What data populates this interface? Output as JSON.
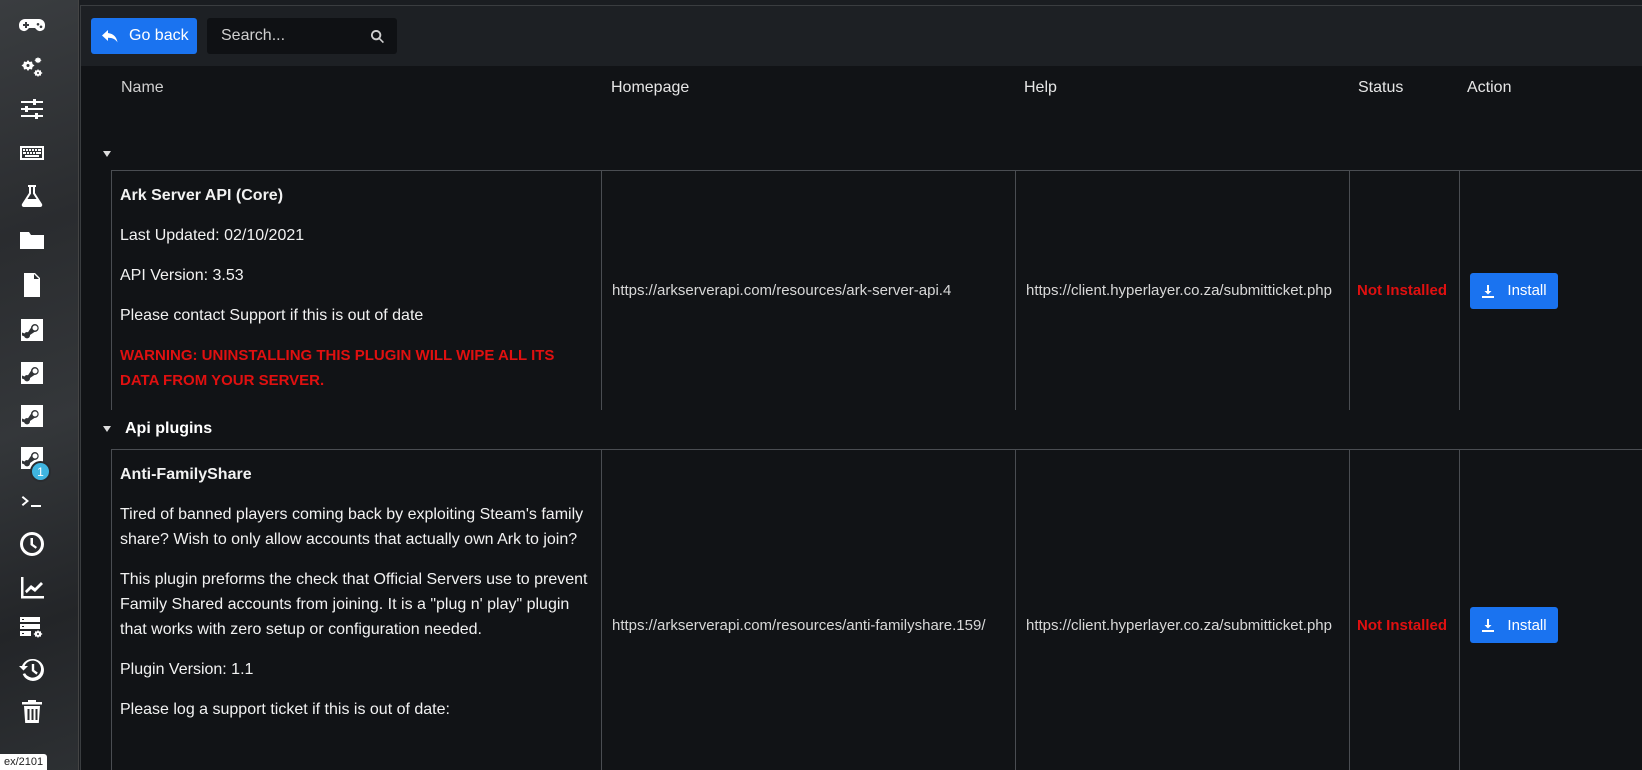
{
  "sidebar": {
    "items": [
      {
        "icon": "gamepad-icon"
      },
      {
        "icon": "gears-icon"
      },
      {
        "icon": "sliders-icon"
      },
      {
        "icon": "keyboard-icon"
      },
      {
        "icon": "flask-icon"
      },
      {
        "icon": "folder-icon"
      },
      {
        "icon": "file-pulse-icon"
      },
      {
        "icon": "steam-icon"
      },
      {
        "icon": "steam-icon"
      },
      {
        "icon": "steam-icon"
      },
      {
        "icon": "steam-icon"
      },
      {
        "icon": "terminal-icon"
      },
      {
        "icon": "clock-icon"
      },
      {
        "icon": "chart-line-icon"
      },
      {
        "icon": "server-settings-icon"
      },
      {
        "icon": "history-icon"
      },
      {
        "icon": "trash-icon"
      }
    ],
    "badge": "1",
    "url_hint": "ex/2101"
  },
  "toolbar": {
    "back_label": "Go back",
    "search_placeholder": "Search..."
  },
  "table": {
    "headers": {
      "name": "Name",
      "homepage": "Homepage",
      "help": "Help",
      "status": "Status",
      "action": "Action"
    }
  },
  "groups": [
    {
      "label": "",
      "plugins": [
        {
          "title": "Ark Server API (Core)",
          "lines": [
            "Last Updated: 02/10/2021",
            "API Version: 3.53",
            "Please contact Support if this is out of date"
          ],
          "warning": "WARNING: UNINSTALLING THIS PLUGIN WILL WIPE ALL ITS DATA FROM YOUR SERVER.",
          "homepage": "https://arkserverapi.com/resources/ark-server-api.4",
          "help": "https://client.hyperlayer.co.za/submitticket.php",
          "status": "Not Installed",
          "action_label": "Install"
        }
      ]
    },
    {
      "label": "Api plugins",
      "plugins": [
        {
          "title": "Anti-FamilyShare",
          "lines": [
            "Tired of banned players coming back by exploiting Steam's family share? Wish to only allow accounts that actually own Ark to join?",
            "This plugin preforms the check that Official Servers use to prevent Family Shared accounts from joining. It is a \"plug n' play\" plugin that works with zero setup or configuration needed.",
            "Plugin Version: 1.1",
            "Please log a support ticket if this is out of date:"
          ],
          "homepage": "https://arkserverapi.com/resources/anti-familyshare.159/",
          "help": "https://client.hyperlayer.co.za/submitticket.php",
          "status": "Not Installed",
          "action_label": "Install"
        }
      ]
    }
  ]
}
